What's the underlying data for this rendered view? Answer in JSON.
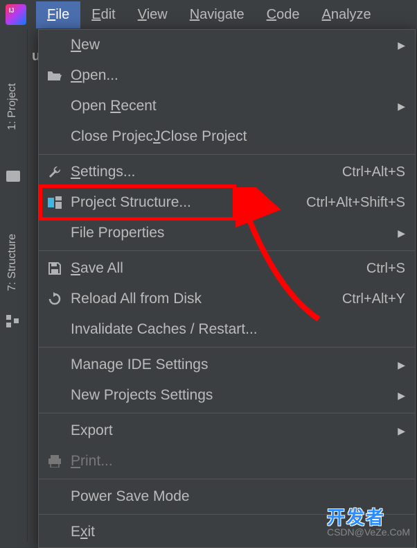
{
  "menubar": {
    "items": [
      "File",
      "Edit",
      "View",
      "Navigate",
      "Code",
      "Analyze"
    ],
    "underlines": [
      "F",
      "E",
      "V",
      "N",
      "C",
      "A"
    ]
  },
  "sidebar": {
    "project_label": "1: Project",
    "structure_label": "7: Structure"
  },
  "project_hint": "un",
  "dropdown": {
    "items": [
      {
        "label": "New",
        "underline": "N",
        "icon": "",
        "shortcut": "",
        "hasSubmenu": true
      },
      {
        "label": "Open...",
        "underline": "O",
        "icon": "folder-open",
        "shortcut": "",
        "hasSubmenu": false
      },
      {
        "label": "Open Recent",
        "underline": "R",
        "icon": "",
        "shortcut": "",
        "hasSubmenu": true
      },
      {
        "label": "Close Project",
        "underline": "J",
        "icon": "",
        "shortcut": "",
        "hasSubmenu": false
      },
      {
        "separator": true
      },
      {
        "label": "Settings...",
        "underline": "S",
        "icon": "wrench",
        "shortcut": "Ctrl+Alt+S",
        "hasSubmenu": false
      },
      {
        "label": "Project Structure...",
        "underline": "",
        "icon": "project-structure",
        "shortcut": "Ctrl+Alt+Shift+S",
        "hasSubmenu": false
      },
      {
        "label": "File Properties",
        "underline": "",
        "icon": "",
        "shortcut": "",
        "hasSubmenu": true
      },
      {
        "separator": true
      },
      {
        "label": "Save All",
        "underline": "S",
        "icon": "save",
        "shortcut": "Ctrl+S",
        "hasSubmenu": false
      },
      {
        "label": "Reload All from Disk",
        "underline": "",
        "icon": "reload",
        "shortcut": "Ctrl+Alt+Y",
        "hasSubmenu": false
      },
      {
        "label": "Invalidate Caches / Restart...",
        "underline": "",
        "icon": "",
        "shortcut": "",
        "hasSubmenu": false
      },
      {
        "separator": true
      },
      {
        "label": "Manage IDE Settings",
        "underline": "",
        "icon": "",
        "shortcut": "",
        "hasSubmenu": true
      },
      {
        "label": "New Projects Settings",
        "underline": "",
        "icon": "",
        "shortcut": "",
        "hasSubmenu": true
      },
      {
        "separator": true
      },
      {
        "label": "Export",
        "underline": "",
        "icon": "",
        "shortcut": "",
        "hasSubmenu": true
      },
      {
        "label": "Print...",
        "underline": "P",
        "icon": "print",
        "shortcut": "",
        "hasSubmenu": false,
        "disabled": true
      },
      {
        "separator": true
      },
      {
        "label": "Power Save Mode",
        "underline": "",
        "icon": "",
        "shortcut": "",
        "hasSubmenu": false
      },
      {
        "separator": true
      },
      {
        "label": "Exit",
        "underline": "x",
        "icon": "",
        "shortcut": "",
        "hasSubmenu": false
      }
    ]
  },
  "watermark": {
    "cn": "开发者",
    "en": "CSDN@VeZe.CoM"
  }
}
